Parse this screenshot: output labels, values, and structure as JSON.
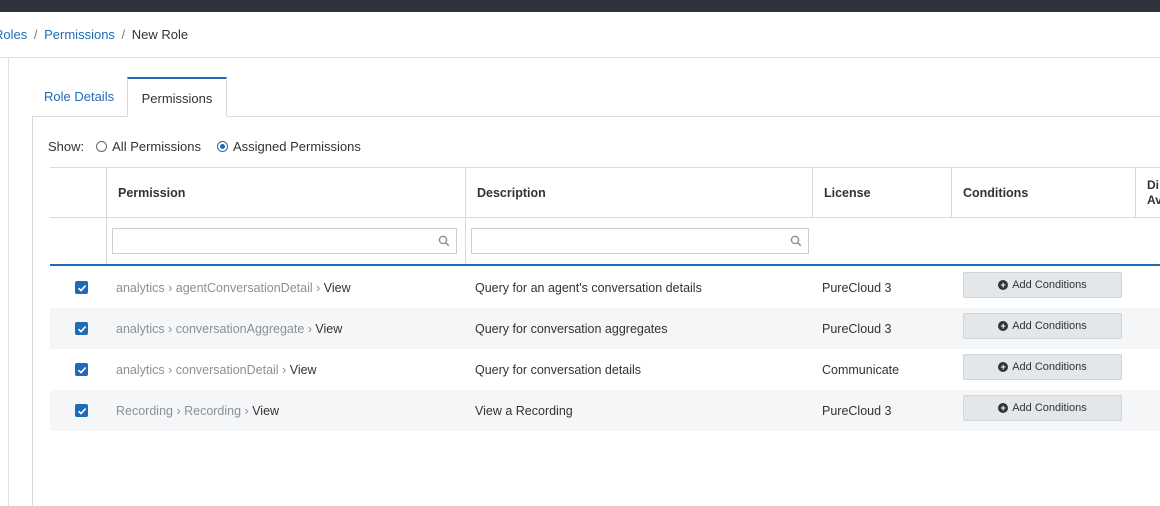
{
  "breadcrumb": {
    "crumbs": [
      "Roles",
      "Permissions"
    ],
    "separator": "/",
    "current": "New Role"
  },
  "tabs": [
    {
      "label": "Role Details",
      "active": false
    },
    {
      "label": "Permissions",
      "active": true
    }
  ],
  "show_filter": {
    "label": "Show:",
    "options": [
      {
        "label": "All Permissions",
        "selected": false
      },
      {
        "label": "Assigned Permissions",
        "selected": true
      }
    ]
  },
  "table": {
    "columns": [
      "Permission",
      "Description",
      "License",
      "Conditions",
      "Di\nAv"
    ],
    "filters": {
      "permission_placeholder": "",
      "description_placeholder": ""
    },
    "rows": [
      {
        "checked": true,
        "path": "analytics › agentConversationDetail ›",
        "action": "View",
        "description": "Query for an agent's conversation details",
        "license": "PureCloud 3",
        "button": "Add Conditions"
      },
      {
        "checked": true,
        "path": "analytics › conversationAggregate ›",
        "action": "View",
        "description": "Query for conversation aggregates",
        "license": "PureCloud 3",
        "button": "Add Conditions"
      },
      {
        "checked": true,
        "path": "analytics › conversationDetail ›",
        "action": "View",
        "description": "Query for conversation details",
        "license": "Communicate",
        "button": "Add Conditions"
      },
      {
        "checked": true,
        "path": "Recording › Recording ›",
        "action": "View",
        "description": "View a Recording",
        "license": "PureCloud 3",
        "button": "Add Conditions"
      }
    ]
  },
  "colors": {
    "accent": "#1e6bb8",
    "topbar": "#2f343c",
    "row_alt": "#f5f6f7"
  }
}
